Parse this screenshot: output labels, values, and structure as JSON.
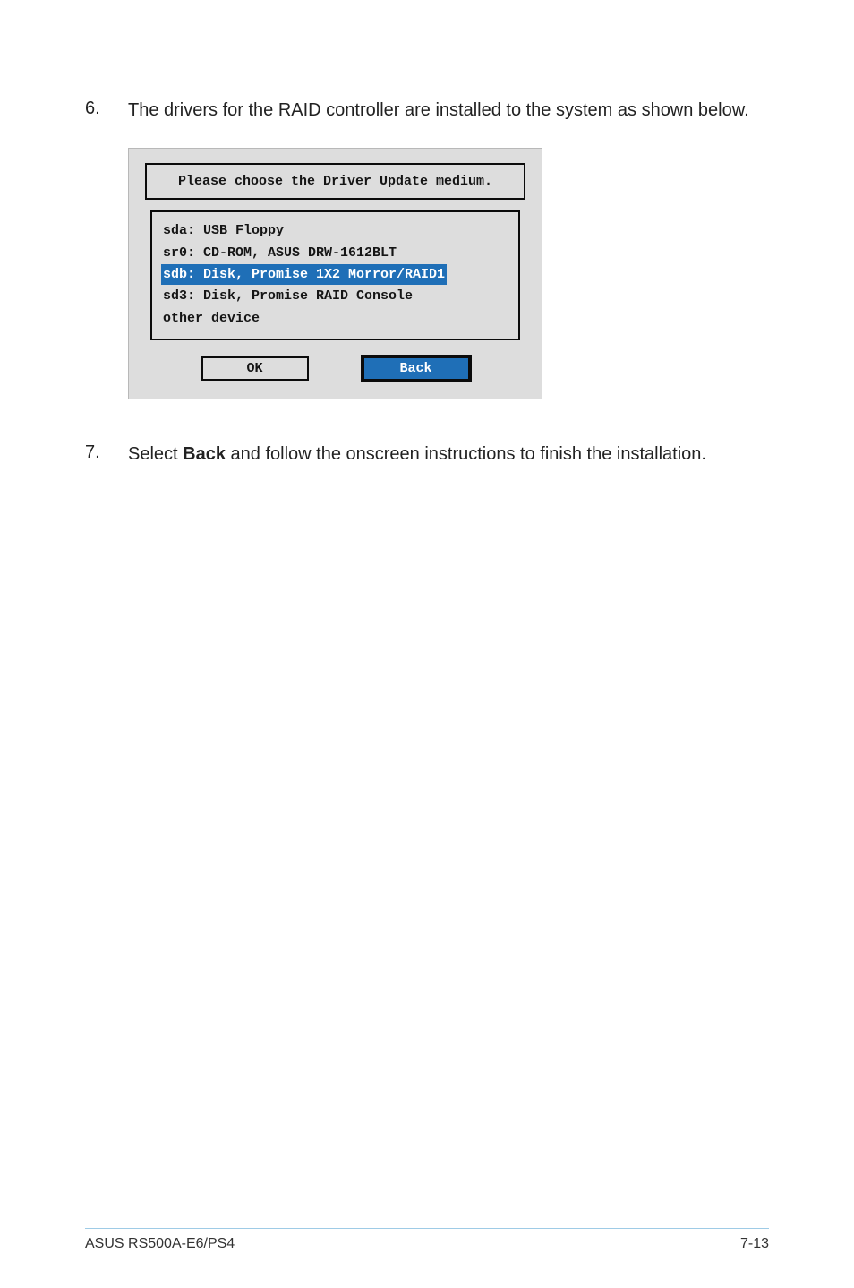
{
  "steps": {
    "s6": {
      "num": "6.",
      "text": "The drivers for the RAID controller are installed to the system as shown below."
    },
    "s7": {
      "num": "7.",
      "prefix": "Select ",
      "bold": "Back",
      "suffix": " and follow the onscreen instructions to finish the installation."
    }
  },
  "dialog": {
    "title": "Please choose the Driver Update medium.",
    "items": {
      "i0": "sda: USB Floppy",
      "i1": "sr0: CD-ROM, ASUS DRW-1612BLT",
      "i2": "sdb: Disk, Promise 1X2 Morror/RAID1",
      "i3": "sd3: Disk, Promise RAID Console",
      "i4": "other device"
    },
    "buttons": {
      "ok": "OK",
      "back": "Back"
    }
  },
  "footer": {
    "left": "ASUS RS500A-E6/PS4",
    "right": "7-13"
  }
}
